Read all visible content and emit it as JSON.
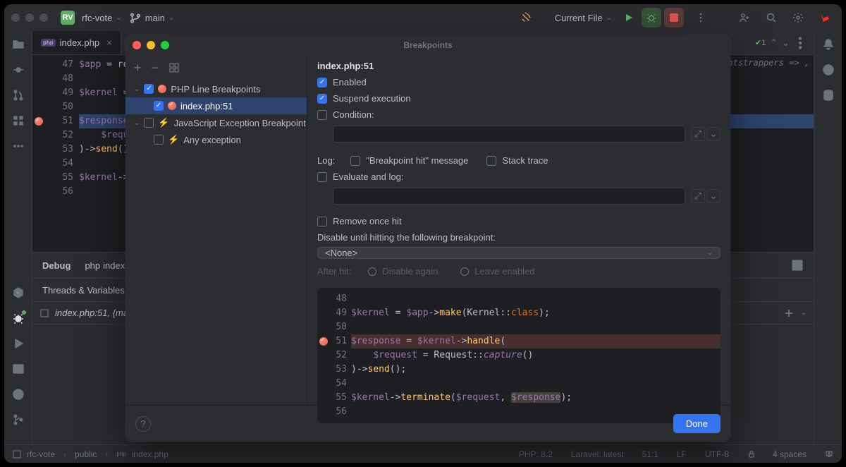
{
  "titlebar": {
    "projectBadge": "RV",
    "projectName": "rfc-vote",
    "branchName": "main",
    "runConfig": "Current File"
  },
  "tabs": {
    "active": {
      "name": "index.php"
    }
  },
  "editor": {
    "lines": [
      47,
      48,
      49,
      50,
      51,
      52,
      53,
      54,
      55,
      56
    ],
    "breakpointLine": 51
  },
  "debugPanel": {
    "tabLabel": "Debug",
    "runTab": "index.",
    "subTab": "Threads & Variables",
    "frame": "index.php:51, {mai"
  },
  "modal": {
    "title": "Breakpoints",
    "toolbar": {
      "add": "+",
      "remove": "−"
    },
    "tree": {
      "group1": "PHP Line Breakpoints",
      "item1": "index.php:51",
      "group2": "JavaScript Exception Breakpoint",
      "item2": "Any exception"
    },
    "right": {
      "heading": "index.php:51",
      "enabled": "Enabled",
      "suspend": "Suspend execution",
      "conditionLabel": "Condition:",
      "logLabel": "Log:",
      "logMsg": "\"Breakpoint hit\" message",
      "stack": "Stack trace",
      "evalLabel": "Evaluate and log:",
      "removeOnce": "Remove once hit",
      "disableUntil": "Disable until hitting the following breakpoint:",
      "selectNone": "<None>",
      "afterHit": "After hit:",
      "opt1": "Disable again",
      "opt2": "Leave enabled",
      "done": "Done",
      "snippetLines": [
        48,
        49,
        50,
        51,
        52,
        53,
        54,
        55,
        56
      ]
    }
  },
  "statusbar": {
    "crumb1": "rfc-vote",
    "crumb2": "public",
    "crumb3": "index.php",
    "php": "PHP: 8.2",
    "laravel": "Laravel: latest",
    "pos": "51:1",
    "le": "LF",
    "enc": "UTF-8",
    "indent": "4 spaces"
  },
  "hints": {
    "green1": "1"
  }
}
